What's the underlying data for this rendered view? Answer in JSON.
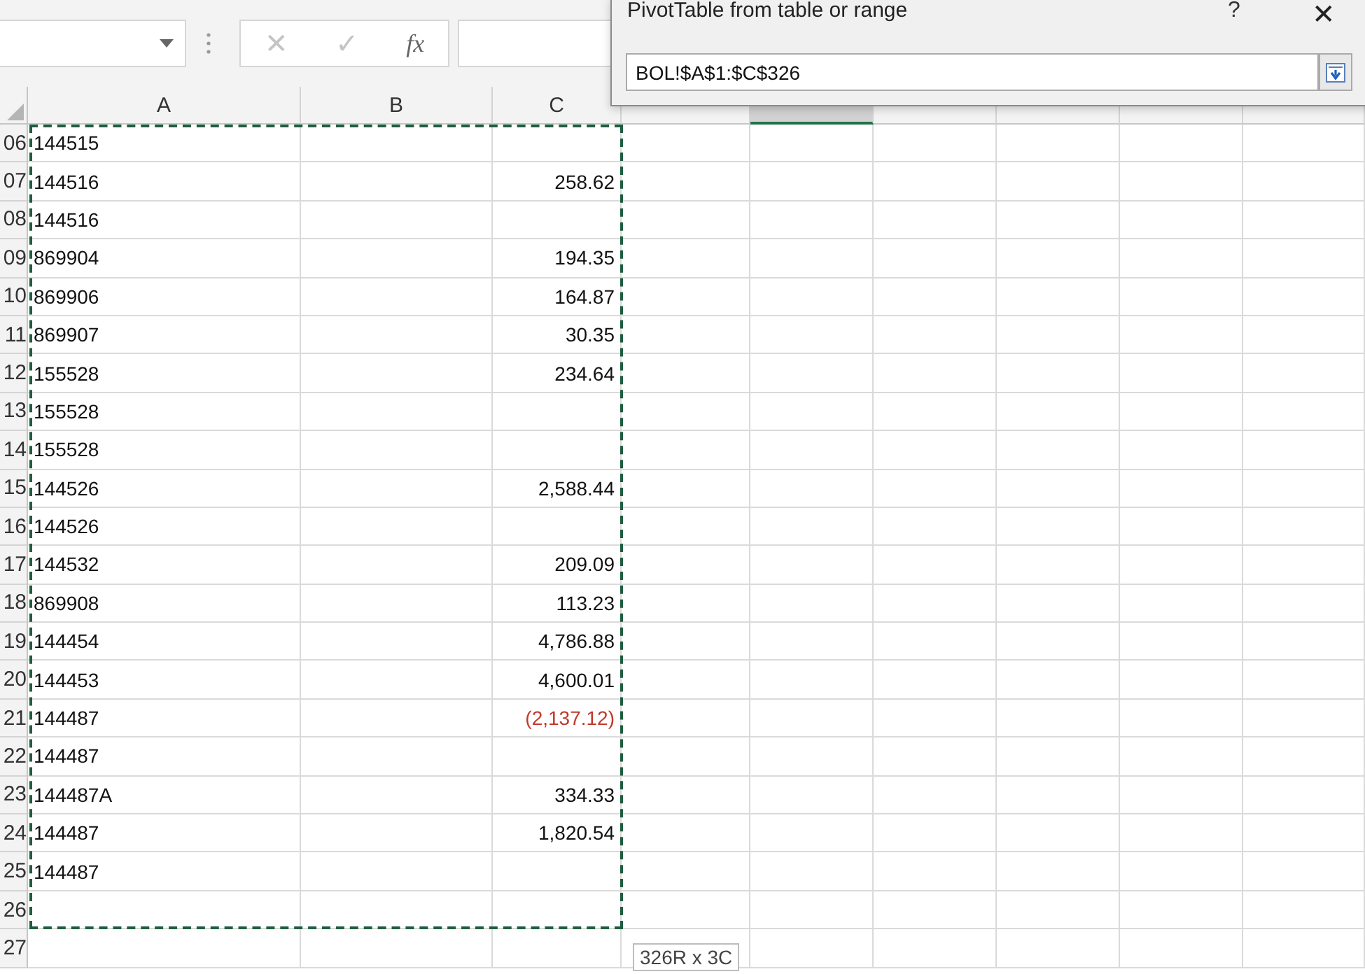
{
  "formula_bar": {
    "cancel_symbol": "✕",
    "enter_symbol": "✓",
    "function_symbol": "fx"
  },
  "columns": [
    {
      "label": "A",
      "selected": false
    },
    {
      "label": "B",
      "selected": false
    },
    {
      "label": "C",
      "selected": false
    },
    {
      "selected": false
    },
    {
      "selected": true
    },
    {
      "selected": false
    },
    {
      "selected": false
    },
    {
      "selected": false
    },
    {
      "selected": false
    }
  ],
  "rows": [
    {
      "number": "06",
      "a": "144515"
    },
    {
      "number": "07",
      "a": "144516",
      "c": "258.62",
      "negative": false
    },
    {
      "number": "08",
      "a": "144516"
    },
    {
      "number": "09",
      "a": "869904",
      "c": "194.35",
      "negative": false
    },
    {
      "number": "10",
      "a": "869906",
      "c": "164.87",
      "negative": false
    },
    {
      "number": "11",
      "a": "869907",
      "c": "30.35",
      "negative": false
    },
    {
      "number": "12",
      "a": "155528",
      "c": "234.64",
      "negative": false
    },
    {
      "number": "13",
      "a": "155528"
    },
    {
      "number": "14",
      "a": "155528"
    },
    {
      "number": "15",
      "a": "144526",
      "c": "2,588.44",
      "negative": false
    },
    {
      "number": "16",
      "a": "144526"
    },
    {
      "number": "17",
      "a": "144532",
      "c": "209.09",
      "negative": false
    },
    {
      "number": "18",
      "a": "869908",
      "c": "113.23",
      "negative": false
    },
    {
      "number": "19",
      "a": "144454",
      "c": "4,786.88",
      "negative": false
    },
    {
      "number": "20",
      "a": "144453",
      "c": "4,600.01",
      "negative": false
    },
    {
      "number": "21",
      "a": "144487",
      "c": "(2,137.12)",
      "negative": true
    },
    {
      "number": "22",
      "a": "144487"
    },
    {
      "number": "23",
      "a": "144487A",
      "c": "334.33",
      "negative": false
    },
    {
      "number": "24",
      "a": "144487",
      "c": "1,820.54",
      "negative": false
    },
    {
      "number": "25",
      "a": "144487"
    },
    {
      "number": "26"
    },
    {
      "number": "27"
    }
  ],
  "selection_tooltip": "326R x 3C",
  "dialog": {
    "title": "PivotTable from table or range",
    "help": "?",
    "close": "✕",
    "range_value": "BOL!$A$1:$C$326"
  }
}
